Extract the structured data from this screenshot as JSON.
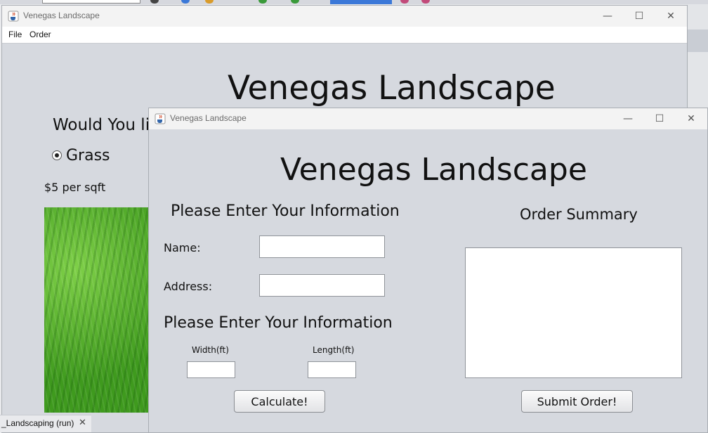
{
  "back_window": {
    "title": "Venegas Landscape",
    "menu": [
      "File",
      "Order"
    ],
    "heading": "Venegas Landscape",
    "question": "Would You li",
    "radio_label": "Grass",
    "price": "$5 per sqft"
  },
  "front_window": {
    "title": "Venegas Landscape",
    "heading": "Venegas Landscape",
    "info_heading": "Please Enter Your Information",
    "name_label": "Name:",
    "address_label": "Address:",
    "name_value": "",
    "address_value": "",
    "dims_heading": "Please Enter Your Information",
    "width_label": "Width(ft)",
    "length_label": "Length(ft)",
    "width_value": "",
    "length_value": "",
    "calculate_label": "Calculate!",
    "summary_heading": "Order Summary",
    "summary_value": "",
    "submit_label": "Submit Order!"
  },
  "taskbar_tab": {
    "label": "_Landscaping (run)",
    "close_glyph": "✕"
  },
  "window_controls": {
    "minimize": "—",
    "maximize": "☐",
    "close": "✕"
  },
  "icons": {
    "app": "java-cup-icon",
    "minimize": "minimize-icon",
    "maximize": "maximize-icon",
    "close": "close-icon"
  },
  "colors": {
    "window_bg": "#d6d9df",
    "accent": "#3b78d8"
  }
}
